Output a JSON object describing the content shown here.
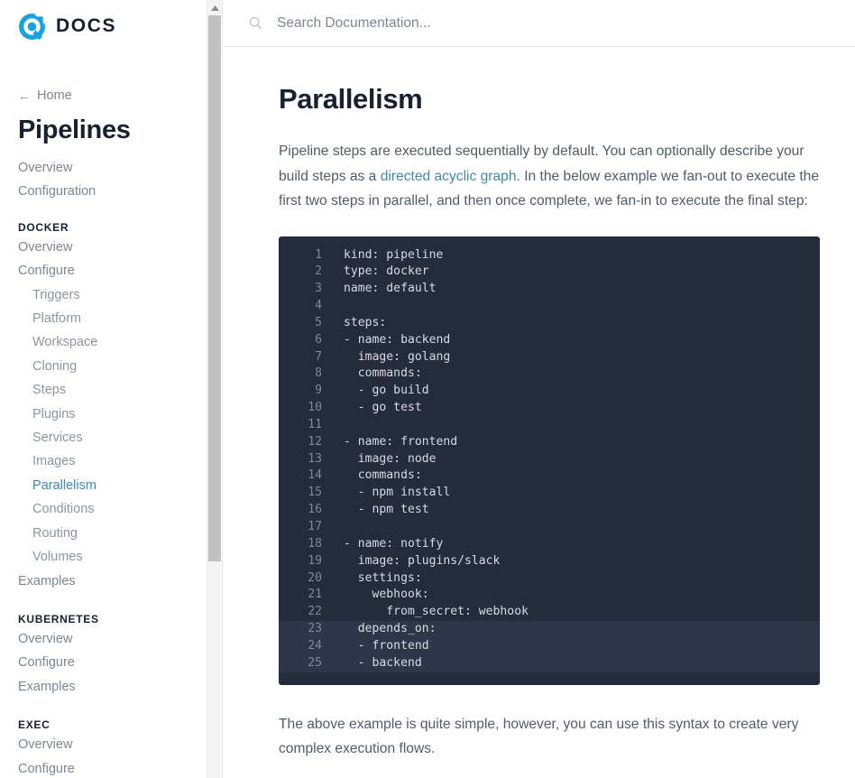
{
  "brand": {
    "name": "DOCS",
    "logo_icon": "drone-logo-icon",
    "logo_color": "#19a3dd"
  },
  "sidebar": {
    "home_label": "Home",
    "home_icon": "arrow-left-icon",
    "section_title": "Pipelines",
    "top_links": [
      {
        "label": "Overview",
        "active": false
      },
      {
        "label": "Configuration",
        "active": false
      }
    ],
    "groups": [
      {
        "heading": "DOCKER",
        "items": [
          {
            "label": "Overview",
            "sub": false,
            "active": false
          },
          {
            "label": "Configure",
            "sub": false,
            "active": false
          },
          {
            "label": "Triggers",
            "sub": true,
            "active": false
          },
          {
            "label": "Platform",
            "sub": true,
            "active": false
          },
          {
            "label": "Workspace",
            "sub": true,
            "active": false
          },
          {
            "label": "Cloning",
            "sub": true,
            "active": false
          },
          {
            "label": "Steps",
            "sub": true,
            "active": false
          },
          {
            "label": "Plugins",
            "sub": true,
            "active": false
          },
          {
            "label": "Services",
            "sub": true,
            "active": false
          },
          {
            "label": "Images",
            "sub": true,
            "active": false
          },
          {
            "label": "Parallelism",
            "sub": true,
            "active": true
          },
          {
            "label": "Conditions",
            "sub": true,
            "active": false
          },
          {
            "label": "Routing",
            "sub": true,
            "active": false
          },
          {
            "label": "Volumes",
            "sub": true,
            "active": false
          },
          {
            "label": "Examples",
            "sub": false,
            "active": false
          }
        ]
      },
      {
        "heading": "KUBERNETES",
        "items": [
          {
            "label": "Overview",
            "sub": false,
            "active": false
          },
          {
            "label": "Configure",
            "sub": false,
            "active": false
          },
          {
            "label": "Examples",
            "sub": false,
            "active": false
          }
        ]
      },
      {
        "heading": "EXEC",
        "items": [
          {
            "label": "Overview",
            "sub": false,
            "active": false
          },
          {
            "label": "Configure",
            "sub": false,
            "active": false
          }
        ]
      }
    ],
    "scrollbar": {
      "up_arrow_icon": "chevron-up-icon",
      "thumb_color": "#c1c1c1"
    }
  },
  "search": {
    "placeholder": "Search Documentation...",
    "value": "",
    "icon": "search-icon"
  },
  "main": {
    "title": "Parallelism",
    "paragraph_1": {
      "before_link": "Pipeline steps are executed sequentially by default. You can optionally describe your build steps as a ",
      "link_text": "directed acyclic graph",
      "after_link": ". In the below example we fan-out to execute the first two steps in parallel, and then once complete, we fan-in to execute the final step:"
    },
    "paragraph_2": "The above example is quite simple, however, you can use this syntax to create very complex execution flows.",
    "link_color": "#3e8aaf"
  },
  "code_block": {
    "language": "yaml",
    "background": "#242b3a",
    "highlight_background": "#2e3647",
    "lines": [
      {
        "n": "1",
        "text": "kind: pipeline",
        "hl": false
      },
      {
        "n": "2",
        "text": "type: docker",
        "hl": false
      },
      {
        "n": "3",
        "text": "name: default",
        "hl": false
      },
      {
        "n": "4",
        "text": "",
        "hl": false
      },
      {
        "n": "5",
        "text": "steps:",
        "hl": false
      },
      {
        "n": "6",
        "text": "- name: backend",
        "hl": false
      },
      {
        "n": "7",
        "text": "  image: golang",
        "hl": false
      },
      {
        "n": "8",
        "text": "  commands:",
        "hl": false
      },
      {
        "n": "9",
        "text": "  - go build",
        "hl": false
      },
      {
        "n": "10",
        "text": "  - go test",
        "hl": false
      },
      {
        "n": "11",
        "text": "",
        "hl": false
      },
      {
        "n": "12",
        "text": "- name: frontend",
        "hl": false
      },
      {
        "n": "13",
        "text": "  image: node",
        "hl": false
      },
      {
        "n": "14",
        "text": "  commands:",
        "hl": false
      },
      {
        "n": "15",
        "text": "  - npm install",
        "hl": false
      },
      {
        "n": "16",
        "text": "  - npm test",
        "hl": false
      },
      {
        "n": "17",
        "text": "",
        "hl": false
      },
      {
        "n": "18",
        "text": "- name: notify",
        "hl": false
      },
      {
        "n": "19",
        "text": "  image: plugins/slack",
        "hl": false
      },
      {
        "n": "20",
        "text": "  settings:",
        "hl": false
      },
      {
        "n": "21",
        "text": "    webhook:",
        "hl": false
      },
      {
        "n": "22",
        "text": "      from_secret: webhook",
        "hl": false
      },
      {
        "n": "23",
        "text": "  depends_on:",
        "hl": true
      },
      {
        "n": "24",
        "text": "  - frontend",
        "hl": true
      },
      {
        "n": "25",
        "text": "  - backend",
        "hl": true
      }
    ]
  }
}
